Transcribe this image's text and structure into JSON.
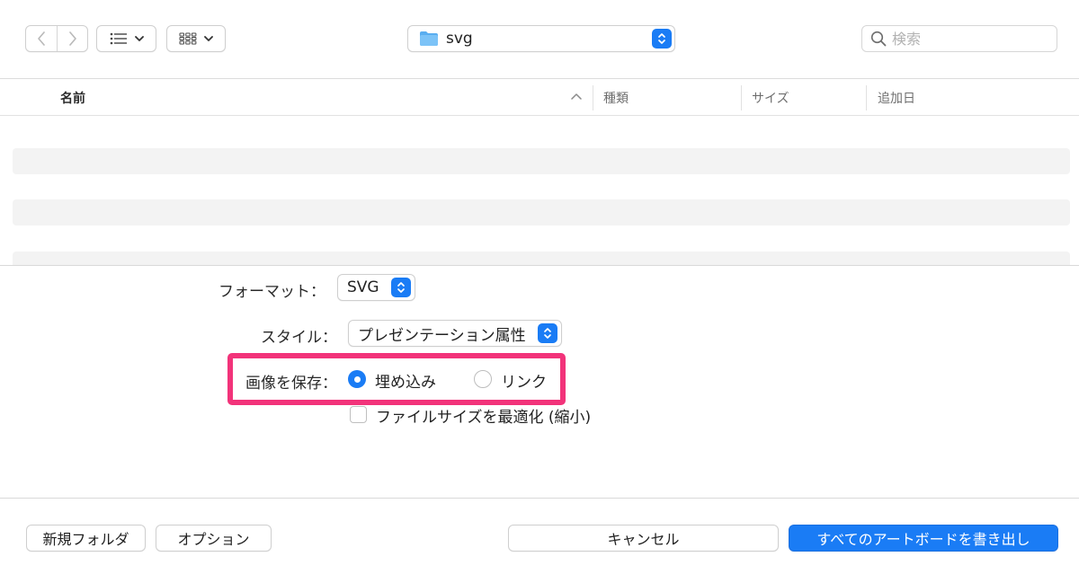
{
  "toolbar": {
    "back_icon": "chevron-left-icon",
    "forward_icon": "chevron-right-icon",
    "list_view_icon": "list-icon",
    "icon_view_icon": "grid-icon",
    "folder_name": "svg",
    "folder_icon": "folder-icon",
    "search_placeholder": "検索"
  },
  "list": {
    "columns": {
      "name": "名前",
      "kind": "種類",
      "size": "サイズ",
      "date": "追加日"
    },
    "sort": "ascending"
  },
  "options": {
    "format": {
      "label": "フォーマット：",
      "value": "SVG"
    },
    "style": {
      "label": "スタイル：",
      "value": "プレゼンテーション属性"
    },
    "image_save": {
      "label": "画像を保存：",
      "embed": "埋め込み",
      "link": "リンク",
      "selected": "埋め込み"
    },
    "optimize": {
      "label": "ファイルサイズを最適化 (縮小)",
      "checked": false
    }
  },
  "buttons": {
    "new_folder": "新規フォルダ",
    "options": "オプション",
    "cancel": "キャンセル",
    "export": "すべてのアートボードを書き出し"
  },
  "colors": {
    "accent": "#1a7cf5",
    "highlight": "#f2337a"
  }
}
